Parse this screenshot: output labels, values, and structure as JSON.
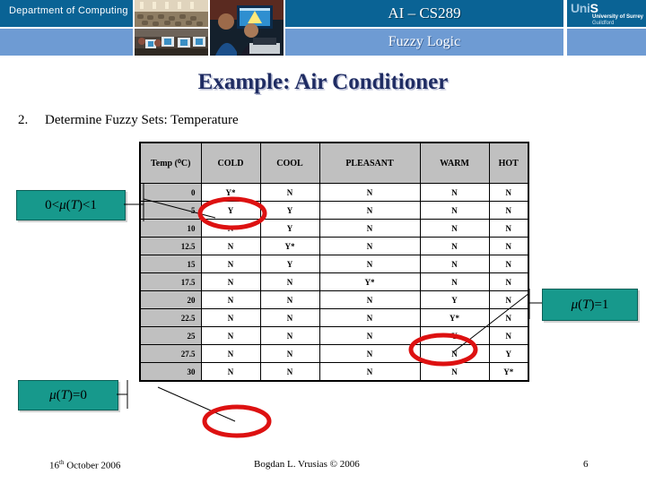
{
  "header": {
    "department": "Department of Computing",
    "course_code": "AI – CS289",
    "course_topic": "Fuzzy Logic",
    "logo": {
      "mark_prefix": "Uni",
      "mark_suffix": "S",
      "line1": "University of Surrey",
      "line2": "Guildford"
    },
    "colors": {
      "dark_blue": "#0A6395",
      "light_blue": "#6E9BD3"
    }
  },
  "slide": {
    "title": "Example: Air Conditioner",
    "bullet_number": "2.",
    "bullet_text": "Determine Fuzzy Sets: Temperature"
  },
  "table": {
    "columns": [
      "Temp (⁰C)",
      "COLD",
      "COOL",
      "PLEASANT",
      "WARM",
      "HOT"
    ],
    "rows": [
      {
        "temp": "0",
        "cells": [
          "Y*",
          "N",
          "N",
          "N",
          "N"
        ]
      },
      {
        "temp": "5",
        "cells": [
          "Y",
          "Y",
          "N",
          "N",
          "N"
        ]
      },
      {
        "temp": "10",
        "cells": [
          "N",
          "Y",
          "N",
          "N",
          "N"
        ]
      },
      {
        "temp": "12.5",
        "cells": [
          "N",
          "Y*",
          "N",
          "N",
          "N"
        ]
      },
      {
        "temp": "15",
        "cells": [
          "N",
          "Y",
          "N",
          "N",
          "N"
        ]
      },
      {
        "temp": "17.5",
        "cells": [
          "N",
          "N",
          "Y*",
          "N",
          "N"
        ]
      },
      {
        "temp": "20",
        "cells": [
          "N",
          "N",
          "N",
          "Y",
          "N"
        ]
      },
      {
        "temp": "22.5",
        "cells": [
          "N",
          "N",
          "N",
          "Y*",
          "N"
        ]
      },
      {
        "temp": "25",
        "cells": [
          "N",
          "N",
          "N",
          "Y",
          "N"
        ]
      },
      {
        "temp": "27.5",
        "cells": [
          "N",
          "N",
          "N",
          "N",
          "Y"
        ]
      },
      {
        "temp": "30",
        "cells": [
          "N",
          "N",
          "N",
          "N",
          "Y*"
        ]
      }
    ]
  },
  "callouts": {
    "between": "0<μ(T)<1",
    "zero": "μ(T)=0",
    "one": "μ(T)=1",
    "color": "#17998C"
  },
  "annotations": {
    "highlight_color": "#DD1111",
    "ellipses": [
      {
        "name": "cold-transition-highlight"
      },
      {
        "name": "warm-transition-highlight"
      },
      {
        "name": "empty-region-highlight"
      }
    ]
  },
  "footer": {
    "date": "16",
    "date_sup": "th",
    "date_rest": " October 2006",
    "author": "Bogdan L. Vrusias © 2006",
    "page": "6"
  }
}
